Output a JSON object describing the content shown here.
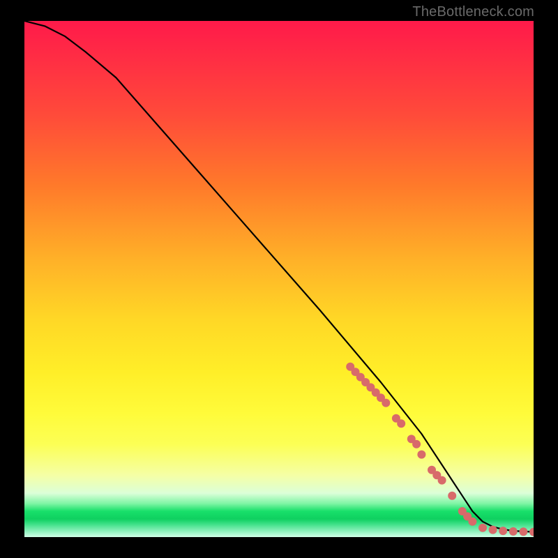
{
  "watermark": "TheBottleneck.com",
  "chart_data": {
    "type": "line",
    "title": "",
    "xlabel": "",
    "ylabel": "",
    "xlim": [
      0,
      100
    ],
    "ylim": [
      0,
      100
    ],
    "grid": false,
    "legend": false,
    "series": [
      {
        "name": "bottleneck-curve",
        "x": [
          0,
          4,
          8,
          12,
          18,
          26,
          34,
          42,
          50,
          58,
          64,
          70,
          74,
          78,
          80,
          82,
          84,
          86,
          88,
          90,
          92,
          94,
          96,
          98,
          100
        ],
        "y": [
          100,
          99,
          97,
          94,
          89,
          80,
          71,
          62,
          53,
          44,
          37,
          30,
          25,
          20,
          17,
          14,
          11,
          8,
          5,
          3,
          2,
          1.5,
          1.2,
          1.1,
          1.0
        ]
      }
    ],
    "highlight_points": {
      "name": "highlight-dots",
      "color": "#d86a6a",
      "x": [
        64,
        65,
        66,
        67,
        68,
        69,
        70,
        71,
        73,
        74,
        76,
        77,
        78,
        80,
        81,
        82,
        84,
        86,
        87,
        88,
        90,
        92,
        94,
        96,
        98,
        100
      ],
      "y": [
        33,
        32,
        31,
        30,
        29,
        28,
        27,
        26,
        23,
        22,
        19,
        18,
        16,
        13,
        12,
        11,
        8,
        5,
        4,
        3,
        1.8,
        1.4,
        1.2,
        1.1,
        1.05,
        1.0
      ]
    }
  }
}
